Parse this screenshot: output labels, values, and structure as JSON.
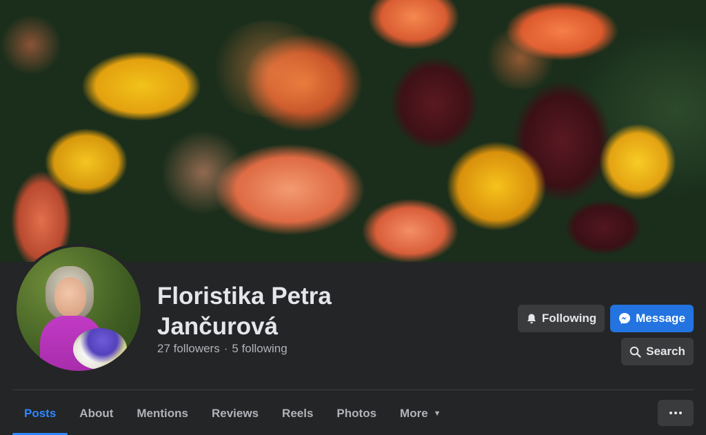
{
  "profile": {
    "name": "Floristika Petra Jančurová",
    "followers": "27 followers",
    "separator": "·",
    "following": "5 following"
  },
  "actions": {
    "following_label": "Following",
    "message_label": "Message",
    "search_label": "Search"
  },
  "tabs": [
    {
      "label": "Posts",
      "active": true
    },
    {
      "label": "About",
      "active": false
    },
    {
      "label": "Mentions",
      "active": false
    },
    {
      "label": "Reviews",
      "active": false
    },
    {
      "label": "Reels",
      "active": false
    },
    {
      "label": "Photos",
      "active": false
    },
    {
      "label": "More",
      "active": false
    }
  ],
  "icons": {
    "following": "bell-icon",
    "message": "messenger-icon",
    "search": "search-icon",
    "more_caret": "caret-down-icon",
    "overflow": "ellipsis-icon"
  },
  "colors": {
    "background": "#242526",
    "accent": "#2d88ff",
    "message_button": "#2374e1",
    "secondary_button": "#3a3b3c",
    "text_primary": "#e4e6eb",
    "text_secondary": "#b0b3b8"
  }
}
